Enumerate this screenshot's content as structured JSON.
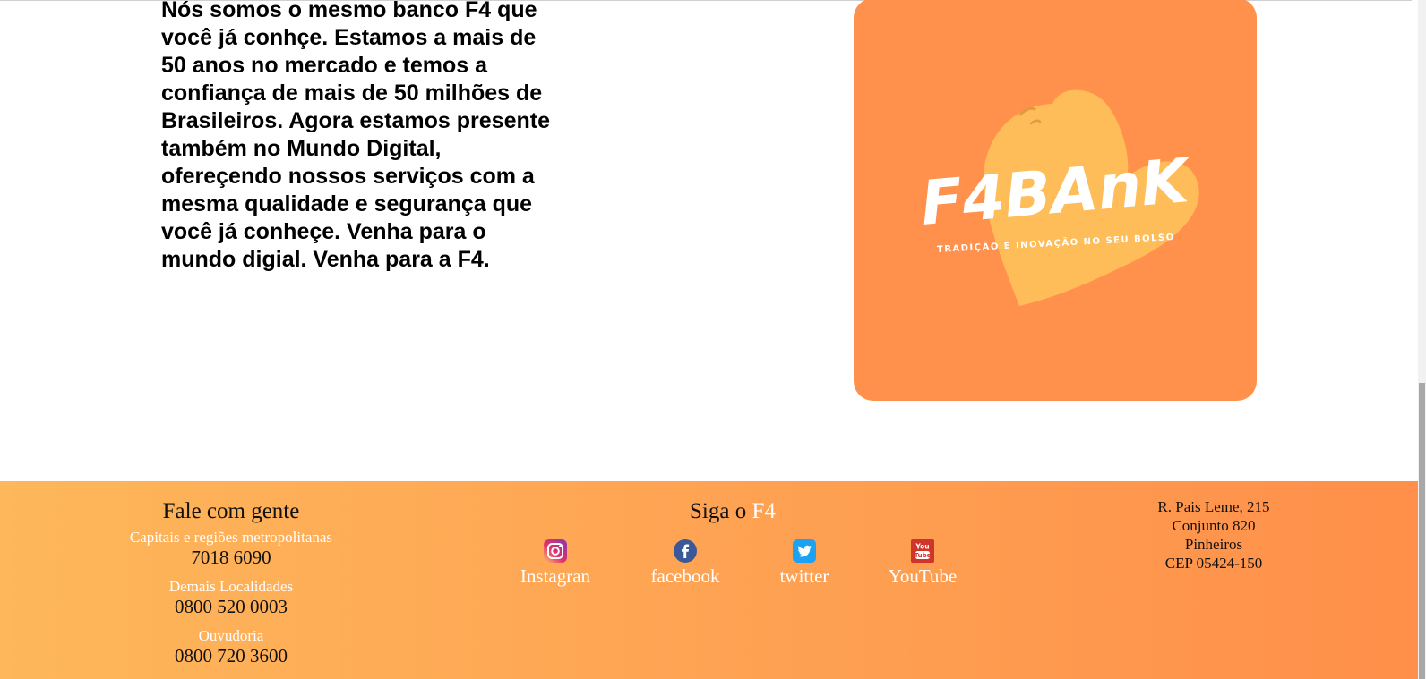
{
  "about": {
    "text": "Nós somos o mesmo banco F4 que você já conhçe. Estamos a mais de 50 anos no mercado e temos a confiança de mais de 50 milhões de Brasileiros. Agora estamos presente também no Mundo Digital, ofereçendo nossos serviços com a mesma qualidade e segurança que você já conheçe. Venha para o mundo digial. Venha para a F4."
  },
  "logo": {
    "brand": "F4BAnK",
    "tagline": "TRADIÇÃO E INOVAÇÃO NO SEU BOLSO",
    "background_color": "#ff914d",
    "heart_color": "#ffbd59"
  },
  "footer": {
    "contact": {
      "title": "Fale com gente",
      "items": [
        {
          "label": "Capitais e regiões metropolitanas",
          "phone": "7018 6090"
        },
        {
          "label": "Demais Localidades",
          "phone": "0800 520 0003"
        },
        {
          "label": "Ouvudoria",
          "phone": "0800 720 3600"
        }
      ]
    },
    "social": {
      "title_prefix": "Siga o ",
      "title_brand": "F4",
      "links": [
        {
          "label": "Instagran",
          "icon": "instagram-icon"
        },
        {
          "label": "facebook",
          "icon": "facebook-icon"
        },
        {
          "label": "twitter",
          "icon": "twitter-icon"
        },
        {
          "label": "YouTube",
          "icon": "youtube-icon"
        }
      ]
    },
    "address": {
      "lines": [
        "R. Pais Leme, 215",
        "Conjunto 820",
        "Pinheiros",
        "CEP 05424-150"
      ]
    },
    "gradient_colors": [
      "#feb75a",
      "#ff8f4a"
    ]
  }
}
